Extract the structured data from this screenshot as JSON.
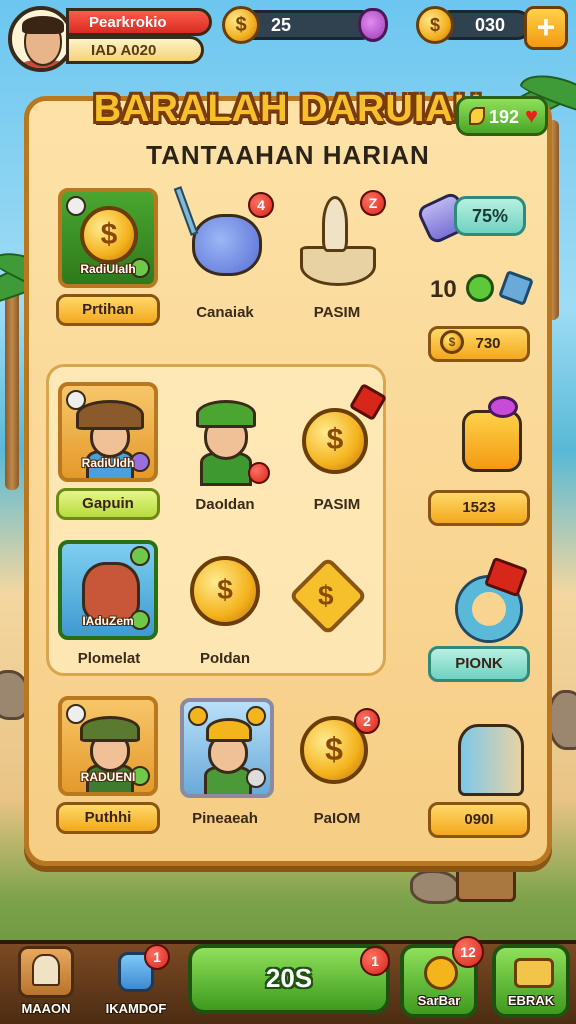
{
  "profile": {
    "name": "Pearkrokio",
    "subtitle": "IAD A020"
  },
  "resources": {
    "coins": "25",
    "gold": "030",
    "plus_label": "+"
  },
  "panel": {
    "title": "BARALAH DARUIAH",
    "subtitle": "TANTAAHAN HARIAN",
    "hearts": "192"
  },
  "rows": [
    {
      "card_label": "RadiUIaIh",
      "card_button": "Prtihan",
      "items": [
        "Canaiak",
        "PASIM"
      ],
      "badges": [
        "4",
        "Z"
      ]
    },
    {
      "card_label": "RadiUIdh",
      "card_button": "Gapuin",
      "items": [
        "DaoIdan",
        "PASIM"
      ]
    },
    {
      "card_label": "IAduZem",
      "card_button": "Plomelat",
      "items": [
        "PoIdan"
      ]
    },
    {
      "card_label": "RADUENI",
      "card_button": "Puthhi",
      "items": [
        "Pineaeah",
        "PaIOM"
      ],
      "badges": [
        "2"
      ]
    }
  ],
  "side": {
    "potion_value": "75%",
    "ten_label": "10",
    "btn1": "730",
    "btn2": "1523",
    "btn3": "PIONK",
    "btn4": "090I"
  },
  "nav": {
    "home": "MAAON",
    "robot": "IKAMDOF",
    "robot_badge": "1",
    "main_value": "20S",
    "main_badge": "1",
    "sarbar": "SarBar",
    "sarbar_badge": "12",
    "ebrak": "EBRAK"
  },
  "colors": {
    "accent": "#f7c12c",
    "panel": "#fde2a8",
    "badge": "#d7271b",
    "nav_green": "#3e9a1e"
  }
}
